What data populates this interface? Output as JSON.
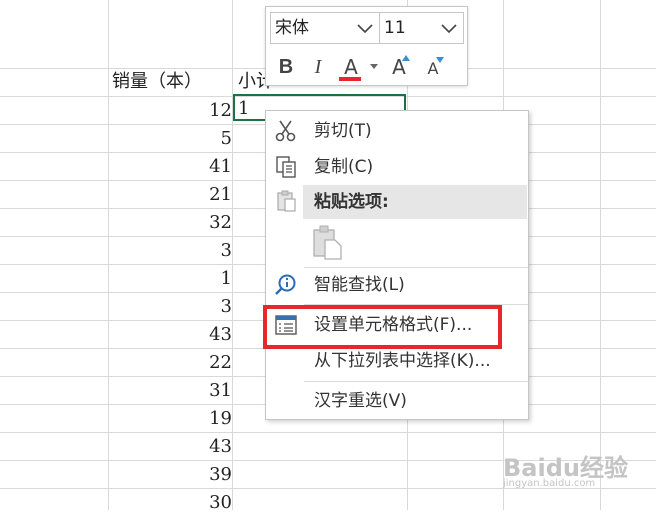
{
  "sheet": {
    "header_sales": "销量（本）",
    "header_subtotal": "小计",
    "selected_value": "1",
    "sales_values": [
      "12",
      "5",
      "41",
      "21",
      "32",
      "3",
      "1",
      "3",
      "43",
      "22",
      "31",
      "19",
      "43",
      "39",
      "30"
    ]
  },
  "mini_toolbar": {
    "font_name": "宋体",
    "font_size": "11",
    "bold": "B",
    "italic": "I",
    "font_color": "A",
    "grow_font": "A",
    "shrink_font": "A",
    "font_color_accent": "#e8272b"
  },
  "context_menu": {
    "cut": "剪切(T)",
    "copy": "复制(C)",
    "paste_options": "粘贴选项:",
    "smart_lookup": "智能查找(L)",
    "format_cells": "设置单元格格式(F)...",
    "pick_from_list": "从下拉列表中选择(K)...",
    "hanzi_reselect": "汉字重选(V)",
    "highlight_color": "#e8272b"
  },
  "watermark": {
    "brand": "Baidu经验",
    "url": "jingyan.baidu.com"
  }
}
